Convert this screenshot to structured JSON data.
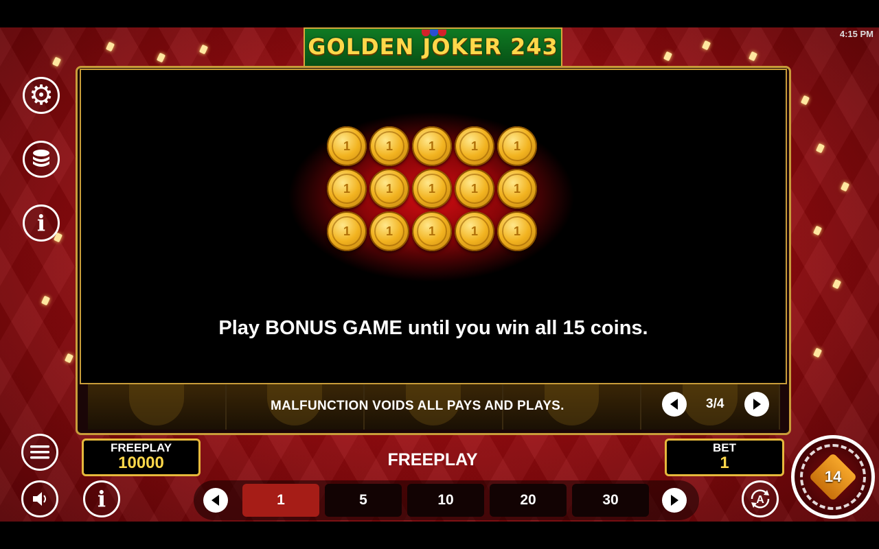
{
  "status": {
    "time": "4:15 PM"
  },
  "game": {
    "title": "GOLDEN JOKER 243"
  },
  "colors": {
    "accent_gold": "#e6b93c",
    "background_red": "#9d0d11",
    "active_bet": "#a61d17",
    "coin_gold": "#f2b320"
  },
  "left_controls": {
    "settings_icon": "gear-icon",
    "coins_icon": "coin-stack-icon",
    "info_icon": "info-icon",
    "menu_icon": "hamburger-menu-icon",
    "sound_icon": "speaker-icon"
  },
  "info_popup": {
    "coin_grid": {
      "rows": 3,
      "columns": 5
    },
    "coin_symbol": "1",
    "text": "Play BONUS GAME until you win all 15 coins.",
    "page_indicator": "3/4"
  },
  "notice": "MALFUNCTION VOIDS ALL PAYS AND PLAYS.",
  "balance": {
    "label": "FREEPLAY",
    "value": "10000"
  },
  "mode_label": "FREEPLAY",
  "bet": {
    "label": "BET",
    "value": "1",
    "options": [
      "1",
      "5",
      "10",
      "20",
      "30"
    ],
    "selected": "1"
  },
  "spin_button": {
    "logo_text": "14"
  },
  "autoplay_label": "A"
}
